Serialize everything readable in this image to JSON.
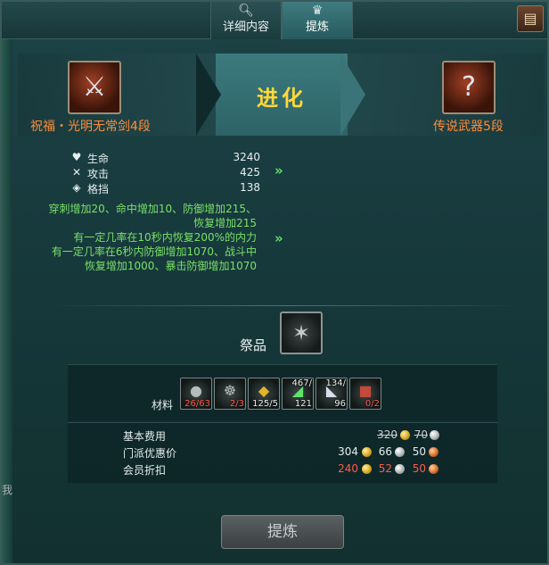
{
  "tabs": [
    {
      "label": "详细内容",
      "icon": "search-icon",
      "active": false
    },
    {
      "label": "提炼",
      "icon": "trophy-icon",
      "active": true
    }
  ],
  "corner_button": {
    "icon": "scroll-icon"
  },
  "evolution": {
    "title": "进化",
    "source_item": {
      "name": "祝福・光明无常剑4段",
      "icon": "sword-icon"
    },
    "target_item": {
      "name": "传说武器5段",
      "icon": "unknown-weapon-icon",
      "glyph": "?"
    }
  },
  "stats": [
    {
      "icon": "heart-icon",
      "label": "生命",
      "value": "3240"
    },
    {
      "icon": "crossed-swords-icon",
      "label": "攻击",
      "value": "425"
    },
    {
      "icon": "shield-icon",
      "label": "格挡",
      "value": "138"
    }
  ],
  "bonuses": {
    "line1": "穿刺增加20、命中增加10、防御增加215、",
    "line2": "恢复增加215",
    "line3": "有一定几率在10秒内恢复200%的内力",
    "line4": "有一定几率在6秒内防御增加1070、战斗中",
    "line5": "恢复增加1000、暴击防御增加1070"
  },
  "arrows": {
    "glyph": "»"
  },
  "offering": {
    "label": "祭品",
    "icon": "dark-weapon-icon"
  },
  "materials": {
    "label": "材料",
    "items": [
      {
        "icon": "dark-orb-icon",
        "count": "26/63",
        "short": true
      },
      {
        "icon": "dragon-icon",
        "count": "2/3",
        "short": true
      },
      {
        "icon": "gold-ingot-icon",
        "count": "125/5",
        "short": false
      },
      {
        "icon": "green-crystal-icon",
        "top": "467/",
        "count": "121",
        "short": false
      },
      {
        "icon": "silver-blade-icon",
        "top": "134/",
        "count": "96",
        "short": false
      },
      {
        "icon": "red-box-icon",
        "count": "0/2",
        "short": true
      }
    ]
  },
  "costs": {
    "base": {
      "label": "基本费用",
      "gold": "320",
      "silver": "70"
    },
    "faction": {
      "label": "门派优惠价",
      "gold": "304",
      "silver": "66",
      "copper": "50"
    },
    "member": {
      "label": "会员折扣",
      "gold": "240",
      "silver": "52",
      "copper": "50"
    }
  },
  "refine_button": {
    "label": "提炼"
  },
  "side_text": "我"
}
